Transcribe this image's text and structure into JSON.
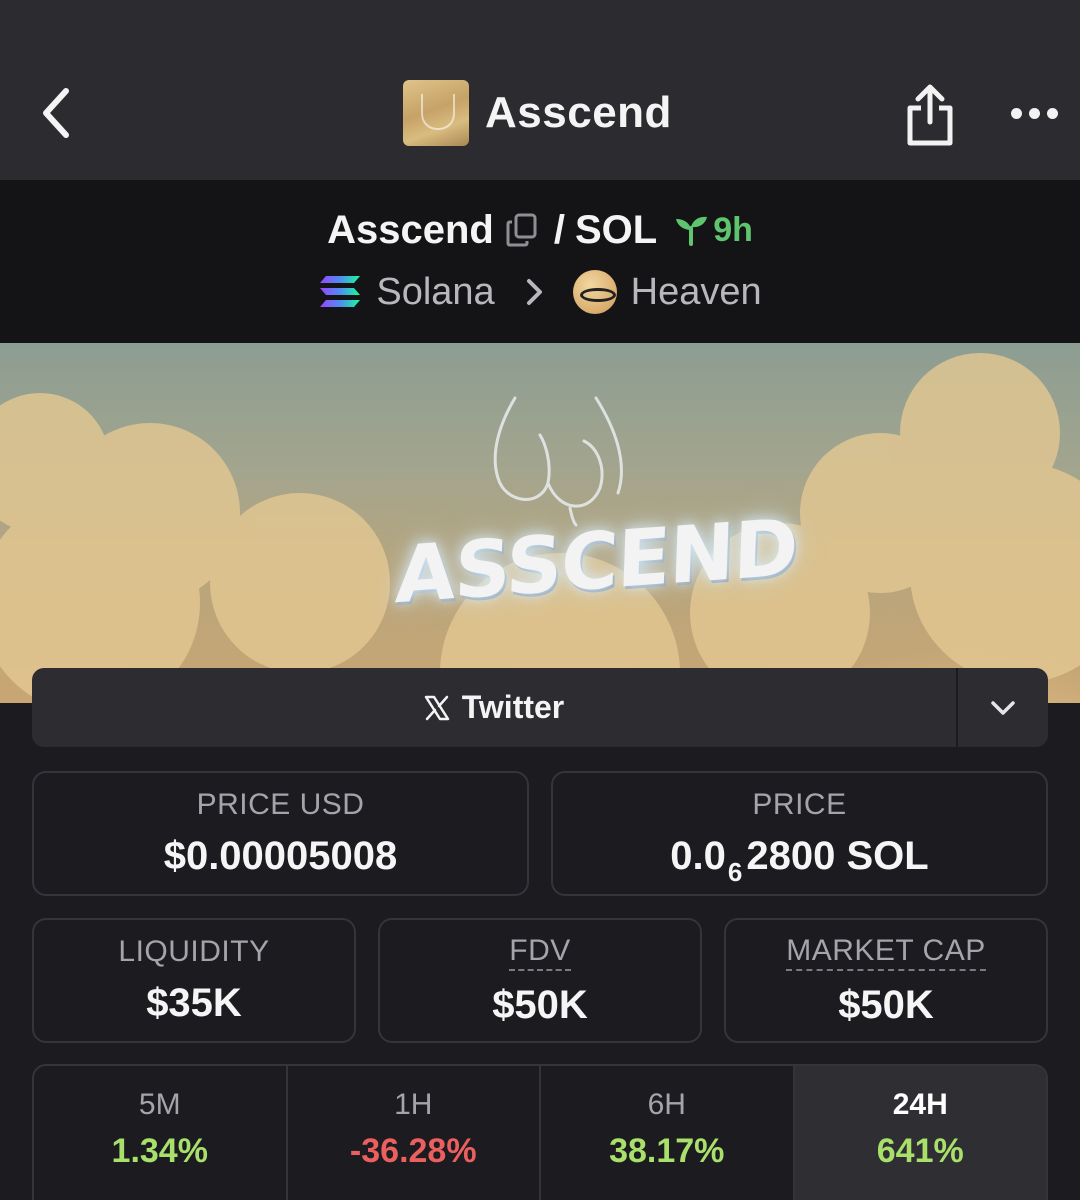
{
  "header": {
    "title": "Asscend"
  },
  "pair": {
    "base": "Asscend",
    "separator": "/",
    "quote": "SOL",
    "age": "9h",
    "chain": "Solana",
    "dex": "Heaven"
  },
  "banner": {
    "wordmark": "ASSCEND"
  },
  "social": {
    "twitter_label": "Twitter"
  },
  "stats": {
    "price_usd": {
      "label": "PRICE USD",
      "value": "$0.00005008"
    },
    "price": {
      "label": "PRICE",
      "prefix": "0.0",
      "zeros": "6",
      "suffix": "2800 SOL"
    },
    "liquidity": {
      "label": "LIQUIDITY",
      "value": "$35K"
    },
    "fdv": {
      "label": "FDV",
      "value": "$50K"
    },
    "market_cap": {
      "label": "MARKET CAP",
      "value": "$50K"
    }
  },
  "timeframes": [
    {
      "label": "5M",
      "change": "1.34%"
    },
    {
      "label": "1H",
      "change": "-36.28%"
    },
    {
      "label": "6H",
      "change": "38.17%"
    },
    {
      "label": "24H",
      "change": "641%"
    }
  ],
  "colors": {
    "positive": "#a8e06b",
    "negative": "#ec5f5f",
    "age_green": "#5ec56e"
  },
  "icons": {
    "back": "chevron-left-icon",
    "share": "share-icon",
    "more": "more-horizontal-icon",
    "copy": "copy-icon",
    "age": "sprout-icon",
    "chain": "solana-logo",
    "dex": "heaven-logo",
    "twitter": "x-logo-icon",
    "dropdown": "chevron-down-icon"
  }
}
